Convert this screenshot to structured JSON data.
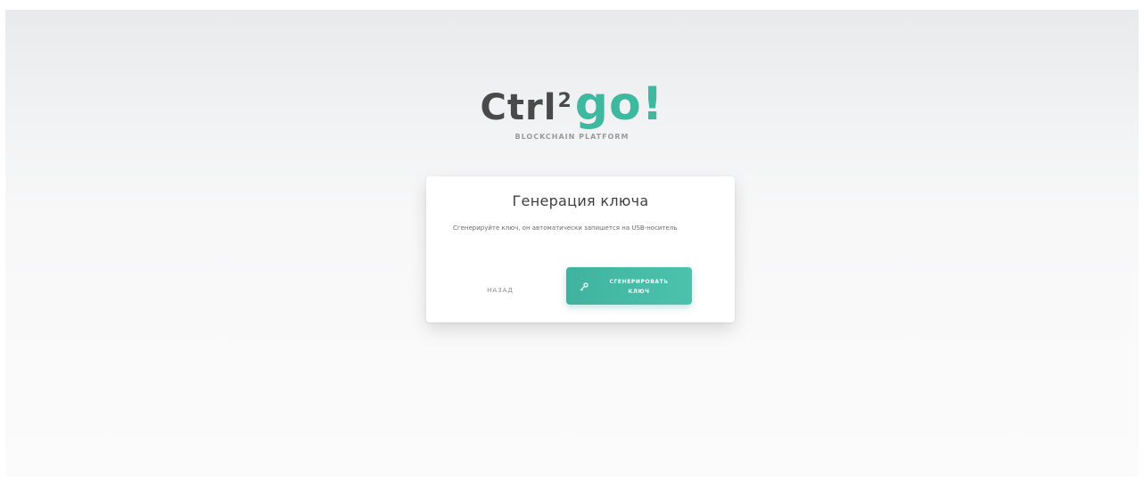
{
  "brand": {
    "logo_ctrl": "Ctrl",
    "logo_sup": "2",
    "logo_go": "go!",
    "tagline": "BLOCKCHAIN PLATFORM",
    "colors": {
      "dark": "#4a4a4a",
      "accent": "#3fb8a0"
    }
  },
  "card": {
    "title": "Генерация ключа",
    "description": "Сгенерируйте ключ, он автоматически запишется на USB-носитель",
    "back_label": "НАЗАД",
    "generate_line1": "СГЕНЕРИРОВАТЬ",
    "generate_line2": "КЛЮЧ",
    "generate_icon": "key-icon"
  }
}
